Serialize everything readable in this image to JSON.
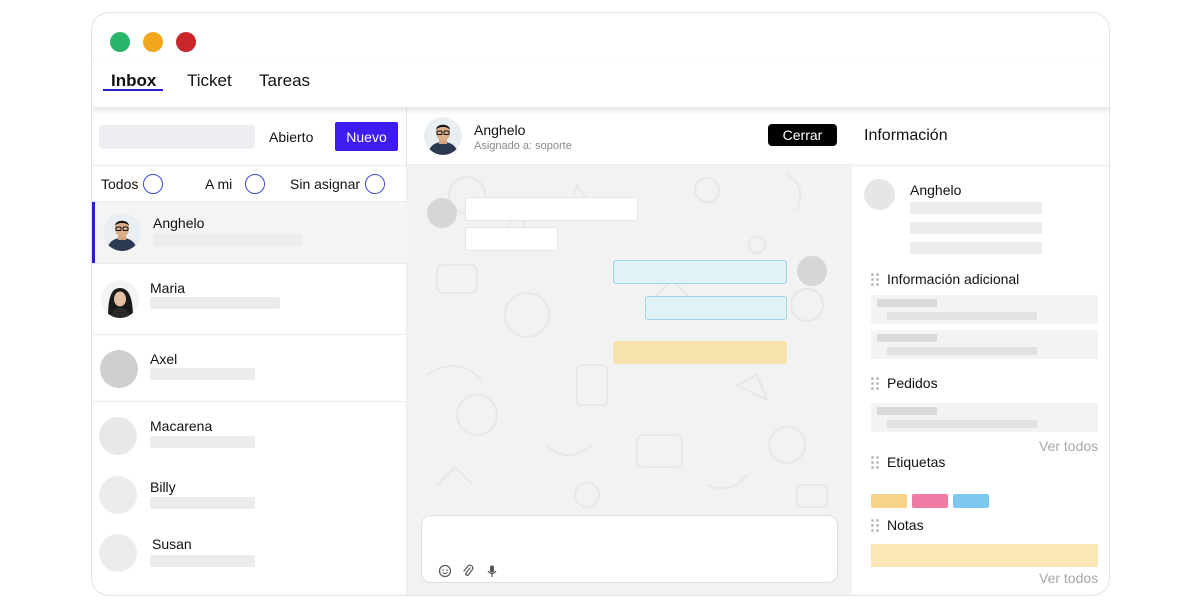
{
  "window": {
    "controls": [
      {
        "name": "maximize",
        "color": "#2bb56a"
      },
      {
        "name": "minimize",
        "color": "#f2a71f"
      },
      {
        "name": "close",
        "color": "#c9262c"
      }
    ]
  },
  "topnav": {
    "tabs": [
      {
        "label": "Inbox",
        "active": true
      },
      {
        "label": "Ticket",
        "active": false
      },
      {
        "label": "Tareas",
        "active": false
      }
    ],
    "accent_color": "#2a1ec6"
  },
  "inbox": {
    "status_label": "Abierto",
    "new_button_label": "Nuevo",
    "new_button_color": "#3d1df0",
    "filters": [
      {
        "label": "Todos"
      },
      {
        "label": "A mi"
      },
      {
        "label": "Sin asignar"
      }
    ],
    "conversations": [
      {
        "name": "Anghelo",
        "avatar": "photo-avatar",
        "selected": true
      },
      {
        "name": "Maria",
        "avatar": "photo-avatar",
        "selected": false
      },
      {
        "name": "Axel",
        "avatar": "placeholder-avatar",
        "selected": false
      },
      {
        "name": "Macarena",
        "avatar": "placeholder-avatar",
        "selected": false
      },
      {
        "name": "Billy",
        "avatar": "placeholder-avatar",
        "selected": false
      },
      {
        "name": "Susan",
        "avatar": "placeholder-avatar",
        "selected": false
      }
    ]
  },
  "chat": {
    "contact_name": "Anghelo",
    "assigned_to": "Asignado a: soporte",
    "close_button_label": "Cerrar",
    "composer_icons": [
      "emoji-icon",
      "paperclip-icon",
      "microphone-icon"
    ]
  },
  "info": {
    "title": "Información",
    "contact_name": "Anghelo",
    "sections": {
      "additional": "Información adicional",
      "orders": "Pedidos",
      "tags": "Etiquetas",
      "notes": "Notas"
    },
    "see_all_label": "Ver todos",
    "tag_colors": [
      "#f6d38b",
      "#ef7aa6",
      "#7cc8ef"
    ],
    "note_color": "#fbe6b5"
  }
}
